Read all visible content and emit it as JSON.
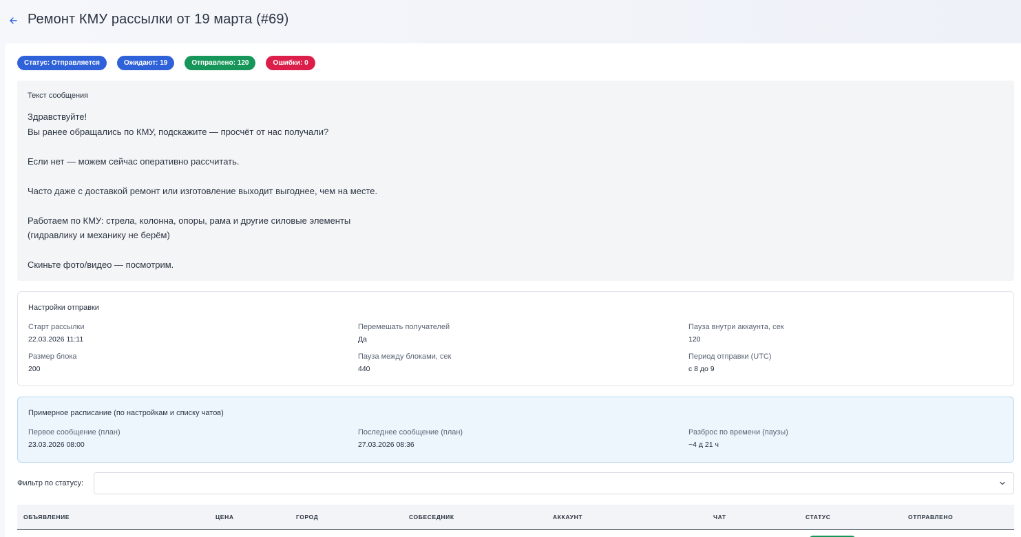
{
  "header": {
    "title": "Ремонт КМУ рассылки от 19 марта (#69)"
  },
  "badges": [
    {
      "label": "Статус: Отправляется",
      "color": "#2f62d9"
    },
    {
      "label": "Ожидают: 19",
      "color": "#2f62d9"
    },
    {
      "label": "Отправлено: 120",
      "color": "#169659"
    },
    {
      "label": "Ошибки: 0",
      "color": "#dc1f4a"
    }
  ],
  "message": {
    "label": "Текст сообщения",
    "lines": [
      "Здравствуйте!",
      "Вы ранее обращались по КМУ, подскажите — просчёт от нас получали?",
      "",
      "Если нет — можем сейчас оперативно рассчитать.",
      "",
      "Часто даже с доставкой ремонт или изготовление выходит выгоднее, чем на месте.",
      "",
      "Работаем по КМУ: стрела, колонна, опоры, рама и другие силовые элементы",
      "(гидравлику и механику не берём)",
      "",
      "Скиньте фото/видео — посмотрим."
    ]
  },
  "settings": {
    "title": "Настройки отправки",
    "fields": [
      {
        "label": "Старт рассылки",
        "value": "22.03.2026 11:11"
      },
      {
        "label": "Перемешать получателей",
        "value": "Да"
      },
      {
        "label": "Пауза внутри аккаунта, сек",
        "value": "120"
      },
      {
        "label": "Размер блока",
        "value": "200"
      },
      {
        "label": "Пауза между блоками, сек",
        "value": "440"
      },
      {
        "label": "Период отправки (UTC)",
        "value": "с 8 до 9"
      }
    ]
  },
  "schedule": {
    "title": "Примерное расписание (по настройкам и списку чатов)",
    "fields": [
      {
        "label": "Первое сообщение (план)",
        "value": "23.03.2026 08:00"
      },
      {
        "label": "Последнее сообщение (план)",
        "value": "27.03.2026 08:36"
      },
      {
        "label": "Разброс по времени (паузы)",
        "value": "~4 д 21 ч"
      }
    ]
  },
  "filter": {
    "label": "Фильтр по статусу:",
    "value": ""
  },
  "table": {
    "columns": [
      "Объявление",
      "Цена",
      "Город",
      "Собеседник",
      "Аккаунт",
      "Чат",
      "Статус",
      "Отправлено"
    ]
  },
  "icons": {
    "back": "arrow-left-icon",
    "select": "chevron-down-icon"
  },
  "colors": {
    "accent_blue": "#2f62d9",
    "success_green": "#169659",
    "error_red": "#dc1f4a",
    "schedule_bg": "#edf5fd"
  }
}
